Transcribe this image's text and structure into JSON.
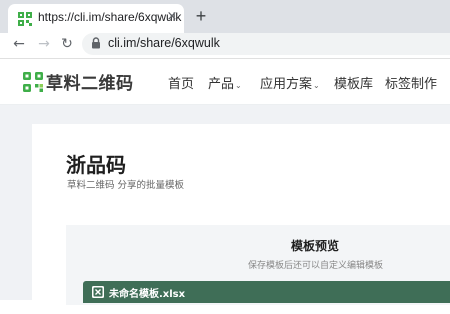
{
  "browser": {
    "tab_title": "https://cli.im/share/6xqwulk",
    "tab_close": "×",
    "new_tab": "+",
    "back": "←",
    "forward": "→",
    "reload": "↻",
    "url": "cli.im/share/6xqwulk"
  },
  "site": {
    "logo_text": "草料二维码",
    "nav": [
      {
        "label": "首页",
        "has_dropdown": false
      },
      {
        "label": "产品",
        "has_dropdown": true
      },
      {
        "label": "应用方案",
        "has_dropdown": true
      },
      {
        "label": "模板库",
        "has_dropdown": false
      },
      {
        "label": "标签制作",
        "has_dropdown": false
      }
    ],
    "caret": "⌄"
  },
  "page": {
    "title": "浙品码",
    "subtitle": "草料二维码 分享的批量模板"
  },
  "preview": {
    "title": "模板预览",
    "hint": "保存模板后还可以自定义编辑模板",
    "file_name": "未命名模板.xlsx"
  },
  "colors": {
    "brand_green": "#3fae49",
    "file_bar": "#3f6e57",
    "tabbar": "#dee1e6"
  }
}
